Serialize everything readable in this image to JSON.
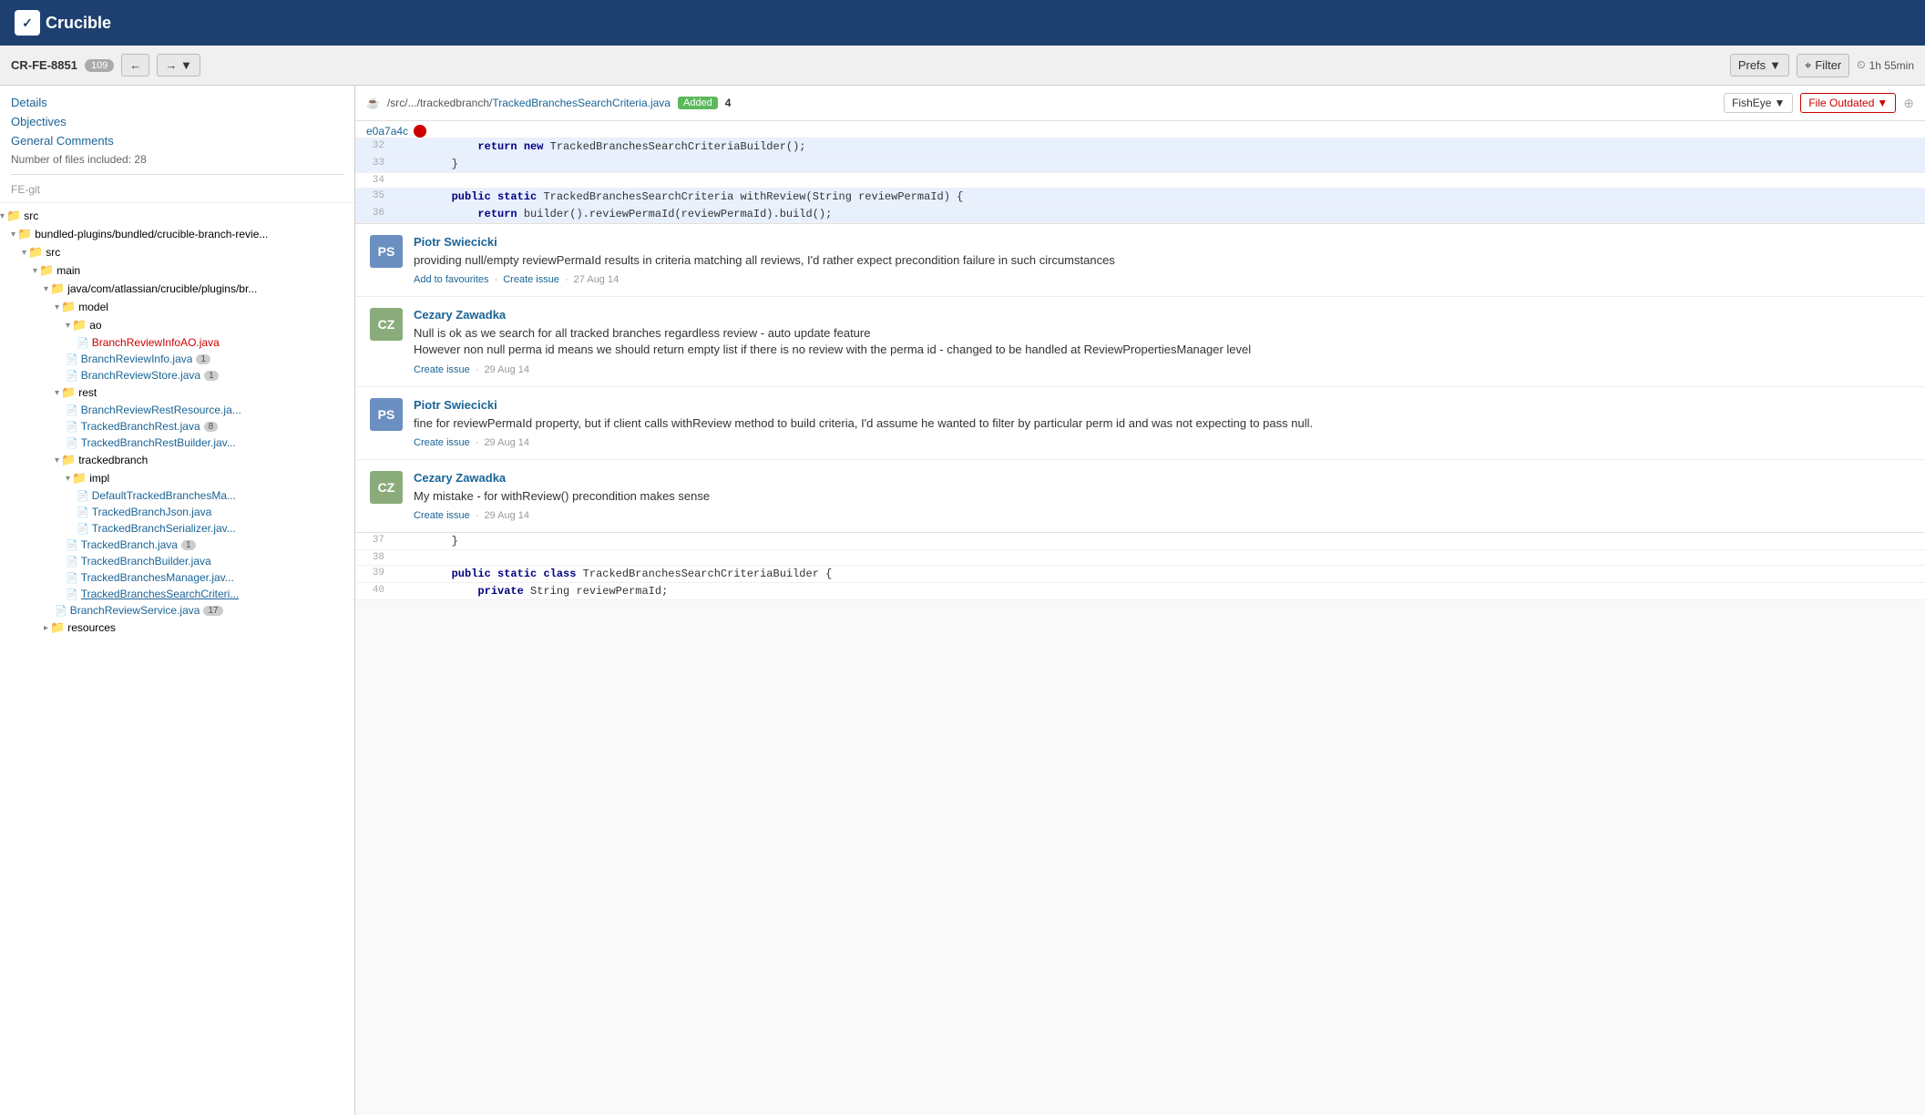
{
  "header": {
    "logo": "Crucible",
    "logo_icon": "✓"
  },
  "review_bar": {
    "review_id": "CR-FE-8851",
    "comment_count": "109",
    "expand_icon": "↔",
    "expand2_icon": "→"
  },
  "toolbar": {
    "prev_icon": "←",
    "next_icon": "→",
    "prefs_label": "Prefs",
    "filter_icon": "⊟",
    "filter_label": "Filter",
    "clock_icon": "⏱",
    "time_label": "1h 55min"
  },
  "sidebar_nav": {
    "details_label": "Details",
    "objectives_label": "Objectives",
    "general_comments_label": "General Comments",
    "file_count_label": "Number of files included: 28",
    "repo_label": "FE-git"
  },
  "file_tree": [
    {
      "id": "src-folder",
      "label": "src",
      "type": "folder",
      "indent": 0,
      "expanded": true
    },
    {
      "id": "bundled-folder",
      "label": "bundled-plugins/bundled/crucible-branch-revie...",
      "type": "folder",
      "indent": 1,
      "expanded": true
    },
    {
      "id": "src2-folder",
      "label": "src",
      "type": "folder",
      "indent": 2,
      "expanded": true
    },
    {
      "id": "main-folder",
      "label": "main",
      "type": "folder",
      "indent": 3,
      "expanded": true
    },
    {
      "id": "java-folder",
      "label": "java/com/atlassian/crucible/plugins/br...",
      "type": "folder",
      "indent": 4,
      "expanded": true
    },
    {
      "id": "model-folder",
      "label": "model",
      "type": "folder",
      "indent": 5,
      "expanded": true
    },
    {
      "id": "ao-folder",
      "label": "ao",
      "type": "folder",
      "indent": 6,
      "expanded": true
    },
    {
      "id": "BranchReviewInfoAO",
      "label": "BranchReviewInfoAO.java",
      "type": "file-red",
      "indent": 7,
      "badge": ""
    },
    {
      "id": "BranchReviewInfo",
      "label": "BranchReviewInfo.java",
      "type": "file-blue",
      "indent": 6,
      "badge": "1"
    },
    {
      "id": "BranchReviewStore",
      "label": "BranchReviewStore.java",
      "type": "file-blue",
      "indent": 6,
      "badge": "1"
    },
    {
      "id": "rest-folder",
      "label": "rest",
      "type": "folder",
      "indent": 5,
      "expanded": true
    },
    {
      "id": "BranchReviewRestResource",
      "label": "BranchReviewRestResource.ja...",
      "type": "file-blue",
      "indent": 6,
      "badge": ""
    },
    {
      "id": "TrackedBranchRest",
      "label": "TrackedBranchRest.java",
      "type": "file-blue",
      "indent": 6,
      "badge": "8"
    },
    {
      "id": "TrackedBranchRestBuilder",
      "label": "TrackedBranchRestBuilder.jav...",
      "type": "file-blue",
      "indent": 6,
      "badge": ""
    },
    {
      "id": "trackedbranch-folder",
      "label": "trackedbranch",
      "type": "folder",
      "indent": 5,
      "expanded": true
    },
    {
      "id": "impl-folder",
      "label": "impl",
      "type": "folder",
      "indent": 6,
      "expanded": true
    },
    {
      "id": "DefaultTrackedBranchesMa",
      "label": "DefaultTrackedBranchesMa...",
      "type": "file-blue",
      "indent": 7,
      "badge": ""
    },
    {
      "id": "TrackedBranchJson",
      "label": "TrackedBranchJson.java",
      "type": "file-blue",
      "indent": 7,
      "badge": ""
    },
    {
      "id": "TrackedBranchSerializer",
      "label": "TrackedBranchSerializer.jav...",
      "type": "file-blue",
      "indent": 7,
      "badge": ""
    },
    {
      "id": "TrackedBranch",
      "label": "TrackedBranch.java",
      "type": "file-blue",
      "indent": 6,
      "badge": "1"
    },
    {
      "id": "TrackedBranchBuilder",
      "label": "TrackedBranchBuilder.java",
      "type": "file-blue",
      "indent": 6,
      "badge": ""
    },
    {
      "id": "TrackedBranchesManager",
      "label": "TrackedBranchesManager.jav...",
      "type": "file-blue",
      "indent": 6,
      "badge": ""
    },
    {
      "id": "TrackedBranchesSearchCriteri",
      "label": "TrackedBranchesSearchCriteri...",
      "type": "file-blue-current",
      "indent": 6,
      "badge": ""
    },
    {
      "id": "BranchReviewService",
      "label": "BranchReviewService.java",
      "type": "file-blue",
      "indent": 5,
      "badge": "17"
    },
    {
      "id": "resources-folder",
      "label": "resources",
      "type": "folder",
      "indent": 4,
      "expanded": false
    }
  ],
  "file_header": {
    "file_icon": "☕",
    "path_prefix": "/src/.../trackedbranch/",
    "file_name": "TrackedBranchesSearchCriteria.java",
    "badge_added": "Added",
    "file_count": "4",
    "fisheye_label": "FishEye",
    "file_outdated_label": "File Outdated",
    "chevron": "▾",
    "icon_compare": "⊞"
  },
  "commit_bar": {
    "hash": "e0a7a4c"
  },
  "code_lines": [
    {
      "num": "32",
      "code": "            return new TrackedBranchesSearchCriteriaBuilder();",
      "highlight": true
    },
    {
      "num": "33",
      "code": "        }",
      "highlight": true
    },
    {
      "num": "34",
      "code": "",
      "highlight": false
    },
    {
      "num": "35",
      "code": "        public static TrackedBranchesSearchCriteria withReview(String reviewPermaId) {",
      "highlight": true
    },
    {
      "num": "36",
      "code": "            return builder().reviewPermaId(reviewPermaId).build();",
      "highlight": true
    }
  ],
  "code_lines_bottom": [
    {
      "num": "37",
      "code": "        }"
    },
    {
      "num": "38",
      "code": ""
    },
    {
      "num": "39",
      "code": "        public static class TrackedBranchesSearchCriteriaBuilder {"
    },
    {
      "num": "40",
      "code": "            private String reviewPermaId;"
    }
  ],
  "comments": [
    {
      "id": "c1",
      "author": "Piotr Swiecicki",
      "avatar_initials": "PS",
      "avatar_class": "ps",
      "text": "providing null/empty reviewPermaId results in criteria matching all reviews, I'd rather expect precondition failure in such circumstances",
      "actions": [
        "Add to favourites",
        "Create issue"
      ],
      "date": "27 Aug 14"
    },
    {
      "id": "c2",
      "author": "Cezary Zawadka",
      "avatar_initials": "CZ",
      "avatar_class": "cz",
      "text": "Null is ok as we search for all tracked branches regardless review - auto update feature\nHowever non null perma id means we should return empty list if there is no review with the perma id - changed to be handled at ReviewPropertiesManager level",
      "actions": [
        "Create issue"
      ],
      "date": "29 Aug 14"
    },
    {
      "id": "c3",
      "author": "Piotr Swiecicki",
      "avatar_initials": "PS",
      "avatar_class": "ps",
      "text": "fine for reviewPermaId property, but if client calls withReview method to build criteria, I'd assume he wanted to filter by particular perm id and was not expecting to pass null.",
      "actions": [
        "Create issue"
      ],
      "date": "29 Aug 14"
    },
    {
      "id": "c4",
      "author": "Cezary Zawadka",
      "avatar_initials": "CZ",
      "avatar_class": "cz",
      "text": "My mistake - for withReview() precondition makes sense",
      "actions": [
        "Create issue"
      ],
      "date": "29 Aug 14"
    }
  ]
}
